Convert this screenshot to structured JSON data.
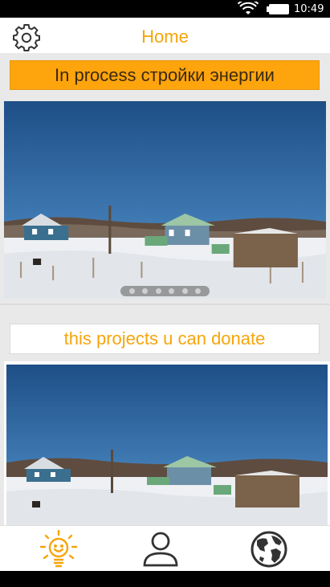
{
  "status_bar": {
    "time": "10:49"
  },
  "app_bar": {
    "title": "Home",
    "settings_icon": "gear-icon"
  },
  "banner": {
    "label": "In process стройки энергии"
  },
  "carousel": {
    "page_count": 6,
    "active_index": 0
  },
  "donate": {
    "label": "this projects u can donate"
  },
  "bottom_nav": [
    {
      "icon": "lightbulb-icon",
      "active": true
    },
    {
      "icon": "user-icon",
      "active": false
    },
    {
      "icon": "globe-icon",
      "active": false
    }
  ],
  "colors": {
    "accent": "#f6a50b",
    "banner": "#fea40d"
  }
}
